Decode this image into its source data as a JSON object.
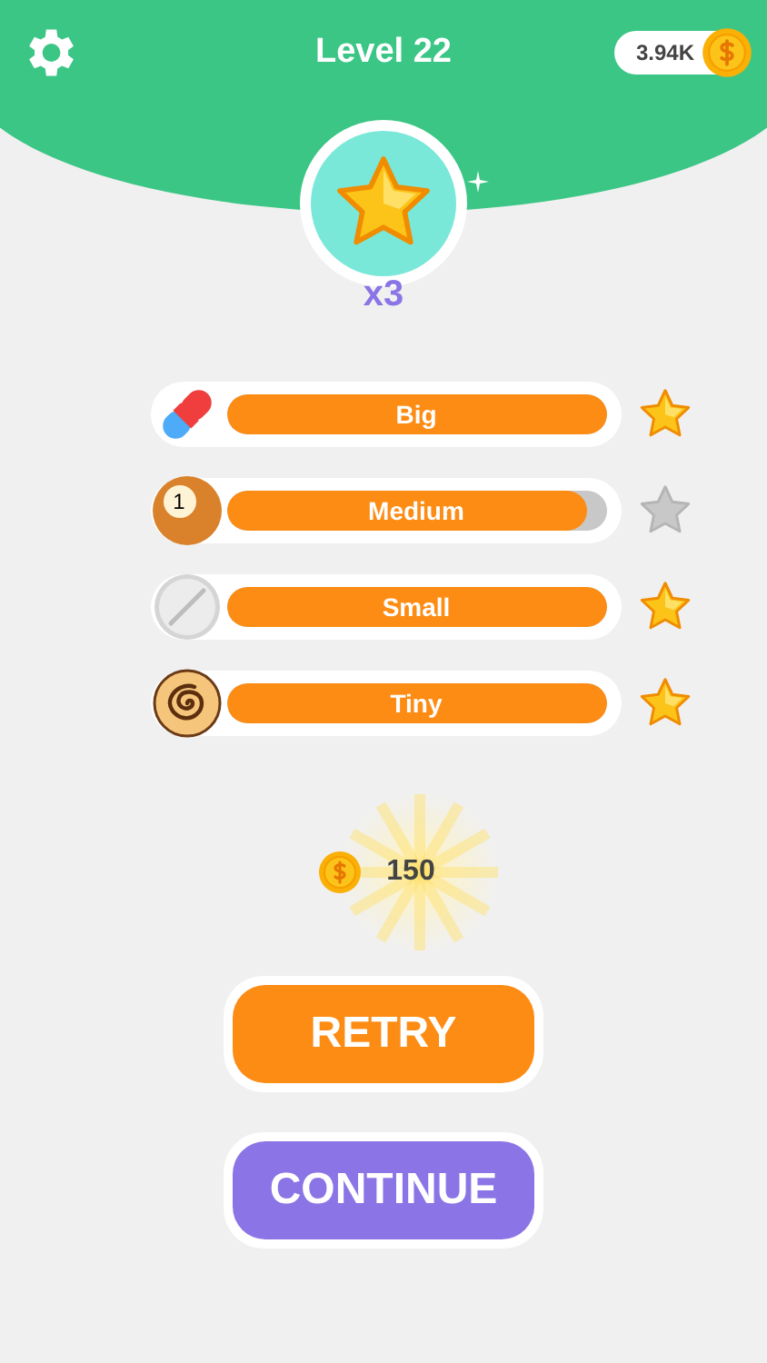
{
  "header": {
    "title": "Level 22",
    "coins": "3.94K"
  },
  "reward": {
    "multiplier": "x3"
  },
  "items": [
    {
      "kind": "pill",
      "label": "Big",
      "level": 1,
      "star": true
    },
    {
      "kind": "ball",
      "ball_number": "1",
      "label": "Medium",
      "level": 0.95,
      "star": false
    },
    {
      "kind": "tablet",
      "label": "Small",
      "level": 1,
      "star": true
    },
    {
      "kind": "roll",
      "label": "Tiny",
      "level": 1,
      "star": true
    }
  ],
  "earned": "150",
  "buttons": [
    {
      "kind": "retry",
      "label": "RETRY"
    },
    {
      "kind": "continue",
      "label": "CONTINUE"
    }
  ]
}
